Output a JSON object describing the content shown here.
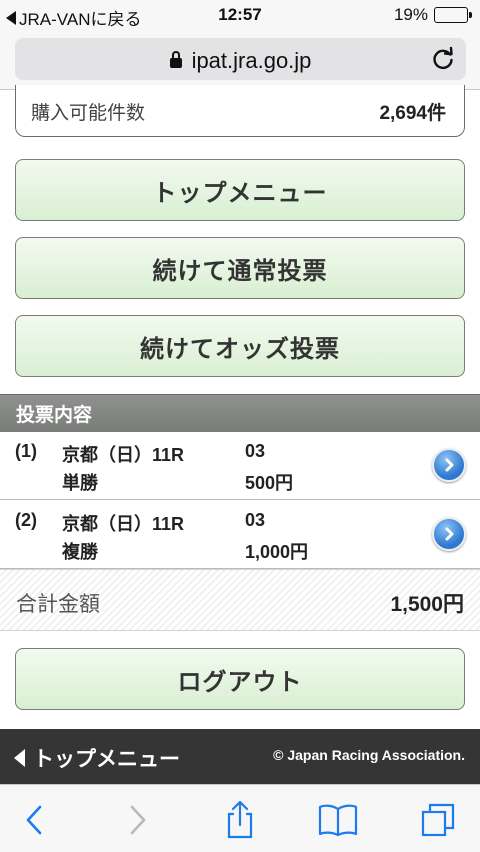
{
  "status_bar": {
    "back_app": "JRA-VANに戻る",
    "time": "12:57",
    "battery_text": "19%",
    "battery_level": 0.19,
    "battery_color": "#f2c21a"
  },
  "browser": {
    "url": "ipat.jra.go.jp",
    "lock_icon": "lock-icon",
    "reload_icon": "reload-icon"
  },
  "purchase_info": {
    "label": "購入可能件数",
    "value": "2,694件"
  },
  "buttons": {
    "top_menu": "トップメニュー",
    "continue_normal": "続けて通常投票",
    "continue_odds": "続けてオッズ投票",
    "logout": "ログアウト"
  },
  "bets": {
    "section_title": "投票内容",
    "items": [
      {
        "num": "(1)",
        "race": "京都（日）11R",
        "horse": "03",
        "type": "単勝",
        "amount": "500円"
      },
      {
        "num": "(2)",
        "race": "京都（日）11R",
        "horse": "03",
        "type": "複勝",
        "amount": "1,000円"
      }
    ]
  },
  "total": {
    "label": "合計金額",
    "value": "1,500円"
  },
  "footer": {
    "back_label": "トップメニュー",
    "copyright": "© Japan Racing Association."
  },
  "toolbar": {
    "icons": [
      "back-icon",
      "forward-icon",
      "share-icon",
      "bookmarks-icon",
      "tabs-icon"
    ]
  },
  "colors": {
    "button_gradient_top": "#f2faee",
    "button_gradient_bottom": "#d9efd3",
    "section_header": "#888b88",
    "footer_bg": "#353535",
    "ios_blue": "#1a7cf0",
    "chevron_button": "#2e78cf"
  }
}
